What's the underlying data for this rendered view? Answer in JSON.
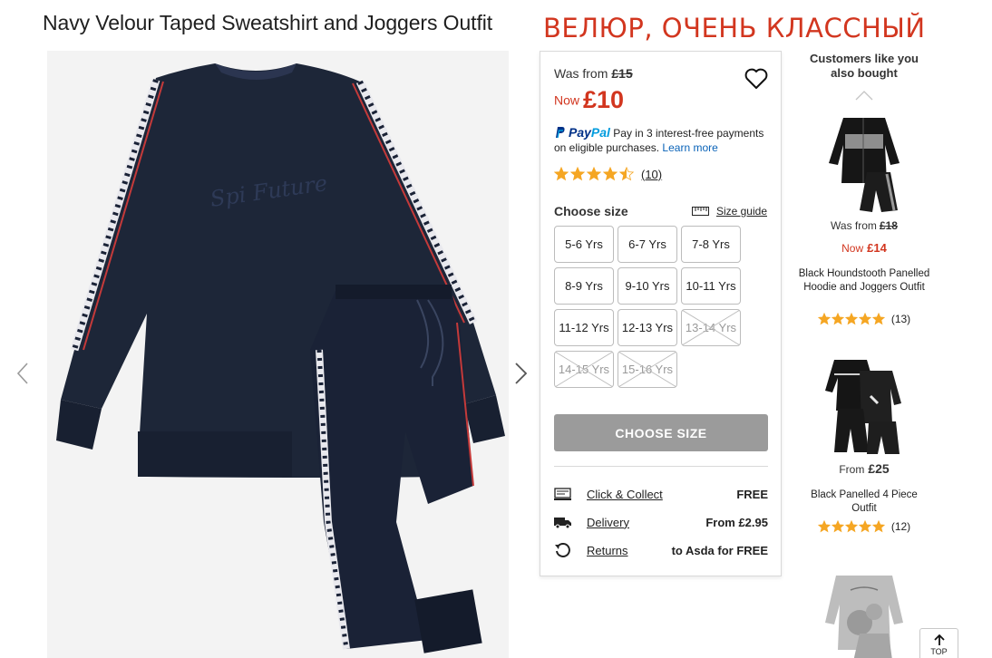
{
  "product": {
    "title": "Navy Velour Taped Sweatshirt and Joggers Outfit",
    "annotation": "ВЕЛЮР, ОЧЕНЬ КЛАССНЫЙ",
    "image_print_text": "Spi Future"
  },
  "pricing": {
    "was_label": "Was from",
    "was_price": "£15",
    "now_label": "Now",
    "now_price": "£10"
  },
  "paypal": {
    "logo_a": "Pay",
    "logo_b": "Pal",
    "text": "Pay in 3 interest-free payments on eligible purchases.",
    "link": "Learn more"
  },
  "rating": {
    "value": 4.5,
    "max": 5,
    "count": "(10)"
  },
  "size": {
    "label": "Choose size",
    "guide": "Size guide",
    "options": [
      {
        "label": "5-6 Yrs",
        "available": true
      },
      {
        "label": "6-7 Yrs",
        "available": true
      },
      {
        "label": "7-8 Yrs",
        "available": true
      },
      {
        "label": "8-9 Yrs",
        "available": true
      },
      {
        "label": "9-10 Yrs",
        "available": true
      },
      {
        "label": "10-11 Yrs",
        "available": true
      },
      {
        "label": "11-12 Yrs",
        "available": true
      },
      {
        "label": "12-13 Yrs",
        "available": true
      },
      {
        "label": "13-14 Yrs",
        "available": false
      },
      {
        "label": "14-15 Yrs",
        "available": false
      },
      {
        "label": "15-16 Yrs",
        "available": false
      }
    ],
    "cta": "CHOOSE SIZE"
  },
  "services": [
    {
      "icon": "click-collect-icon",
      "label": "Click & Collect",
      "value": "FREE"
    },
    {
      "icon": "delivery-truck-icon",
      "label": "Delivery",
      "value": "From £2.95"
    },
    {
      "icon": "returns-icon",
      "label": "Returns",
      "value": "to Asda for FREE"
    }
  ],
  "recommendations": {
    "title": "Customers like you also bought",
    "items": [
      {
        "was_label": "Was from",
        "was_price": "£18",
        "now_label": "Now",
        "now_price": "£14",
        "name": "Black Houndstooth Panelled Hoodie and Joggers Outfit",
        "rating": 5,
        "count": "(13)"
      },
      {
        "from_label": "From",
        "price": "£25",
        "name": "Black Panelled 4 Piece Outfit",
        "rating": 5,
        "count": "(12)"
      },
      {
        "name": ""
      }
    ]
  },
  "back_to_top": "TOP",
  "colors": {
    "accent_red": "#d2361f",
    "star_gold": "#f5a623",
    "cta_grey": "#9b9b9b",
    "paypal_navy": "#003087",
    "paypal_blue": "#009cde",
    "link_blue": "#0a63b8"
  }
}
